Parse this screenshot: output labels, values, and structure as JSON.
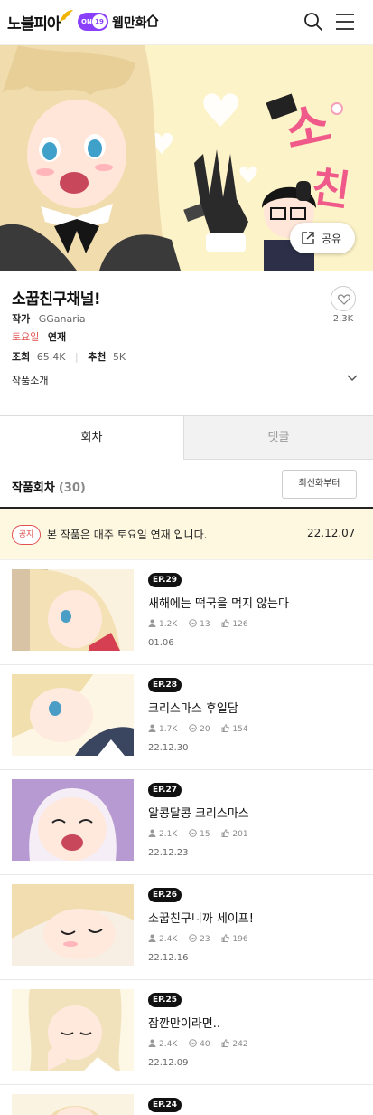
{
  "header": {
    "logo_text": "노블피아",
    "toggle_on": "ON",
    "toggle_age": "19",
    "webtoon_label": "웹만화",
    "icons": [
      "home-icon",
      "search-icon",
      "menu-icon"
    ]
  },
  "banner": {
    "share_label": "공유"
  },
  "work": {
    "title": "소꿉친구채널!",
    "author_label": "작가",
    "author": "GGanaria",
    "day_label": "토요일",
    "status": "연재",
    "views_label": "조회",
    "views": "65.4K",
    "recommend_label": "추천",
    "recommend": "5K",
    "likes": "2.3K",
    "intro_label": "작품소개"
  },
  "tabs": [
    {
      "label": "회차",
      "active": true
    },
    {
      "label": "댓글",
      "active": false
    }
  ],
  "episodes_header": {
    "label": "작품회차",
    "count": "(30)",
    "sort_label": "최신화부터"
  },
  "notice": {
    "badge": "공지",
    "text": "본 작품은 매주 토요일 연재 입니다.",
    "date": "22.12.07"
  },
  "episodes": [
    {
      "ep": "EP.29",
      "title": "새해에는 떡국을 먹지 않는다",
      "views": "1.2K",
      "comments": "13",
      "likes": "126",
      "date": "01.06"
    },
    {
      "ep": "EP.28",
      "title": "크리스마스 후일담",
      "views": "1.7K",
      "comments": "20",
      "likes": "154",
      "date": "22.12.30"
    },
    {
      "ep": "EP.27",
      "title": "알콩달콩 크리스마스",
      "views": "2.1K",
      "comments": "15",
      "likes": "201",
      "date": "22.12.23"
    },
    {
      "ep": "EP.26",
      "title": "소꿉친구니까 세이프!",
      "views": "2.4K",
      "comments": "23",
      "likes": "196",
      "date": "22.12.16"
    },
    {
      "ep": "EP.25",
      "title": "잠깐만이라면..",
      "views": "2.4K",
      "comments": "40",
      "likes": "242",
      "date": "22.12.09"
    },
    {
      "ep": "EP.24",
      "title": "",
      "views": "",
      "comments": "",
      "likes": "",
      "date": ""
    }
  ],
  "colors": {
    "accent_purple": "#8a3ffc",
    "notice_red": "#e05050",
    "notice_bg": "#fff8e0",
    "banner_bg": "#fdf3c8"
  }
}
